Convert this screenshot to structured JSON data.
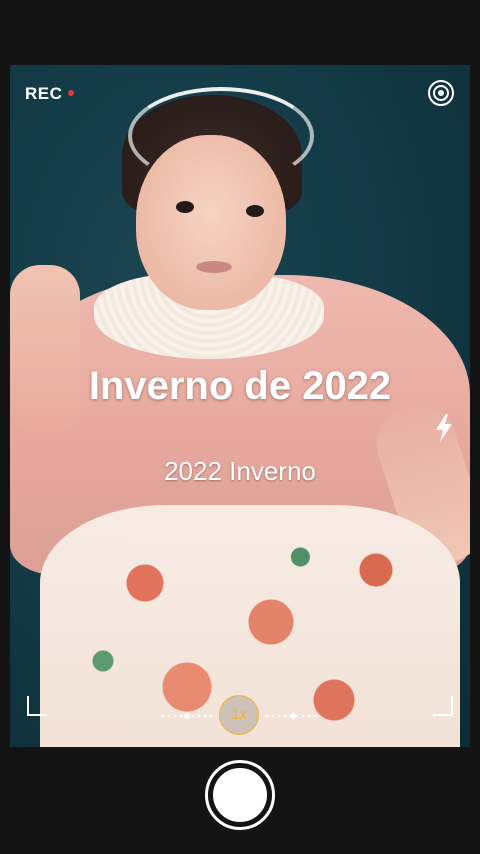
{
  "camera": {
    "rec_label": "REC",
    "overlay_title": "Inverno de 2022",
    "overlay_subtitle": "2022 Inverno",
    "zoom_label": "1x"
  },
  "icons": {
    "live": "live-photo-icon",
    "flash": "flash-icon",
    "shutter": "shutter-button"
  },
  "colors": {
    "accent": "#f2b23a",
    "rec_dot": "#e53935",
    "background": "#141414"
  }
}
